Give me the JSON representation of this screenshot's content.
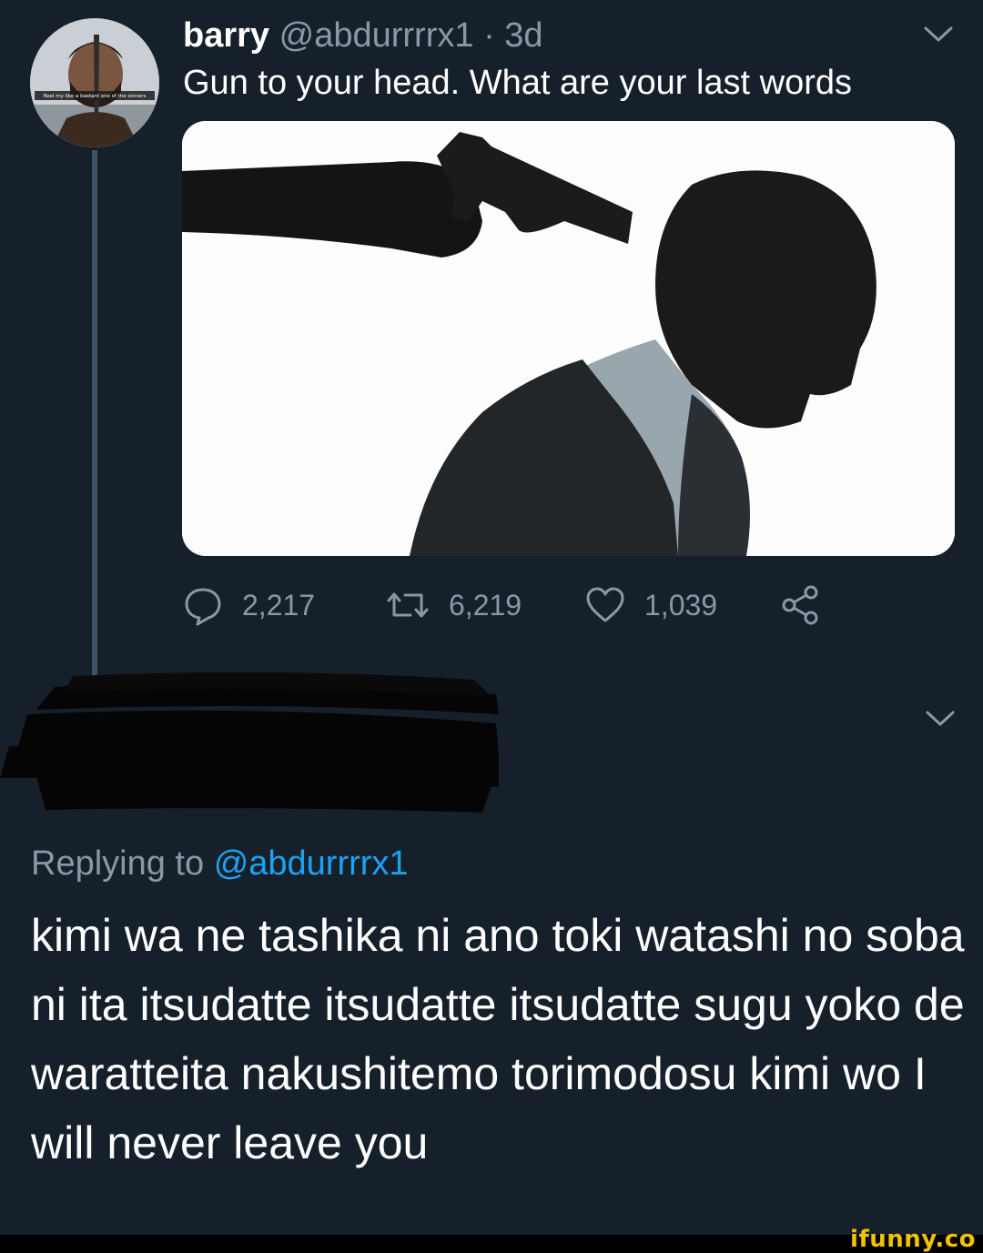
{
  "tweet": {
    "display_name": "barry",
    "handle": "@abdurrrrx1",
    "age": "· 3d",
    "text": "Gun to your head. What are your last words",
    "avatar_caption": "Reel my like a bastard one of the sinners",
    "media_icon": "silhouette-photo-gun-to-head",
    "stats": {
      "replies": "2,217",
      "retweets": "6,219",
      "likes": "1,039"
    }
  },
  "reply": {
    "replying_to_label": "Replying to",
    "replying_to_handle": "@abdurrrrx1",
    "text": "kimi wa ne tashika ni ano toki watashi no soba ni ita itsudatte itsudatte itsudatte sugu yoko de waratteita nakushitemo torimodosu kimi wo I will never leave you"
  },
  "icons": {
    "reply": "comment-bubble-icon",
    "retweet": "retweet-arrows-icon",
    "like": "heart-icon",
    "share": "share-nodes-icon",
    "more": "chevron-down-icon"
  },
  "colors": {
    "background": "#15202b",
    "muted_text": "#8899a6",
    "link": "#1da1f2",
    "thread_line": "#3d5466",
    "watermark": "#f2c200"
  },
  "watermark": "ifunny.co"
}
